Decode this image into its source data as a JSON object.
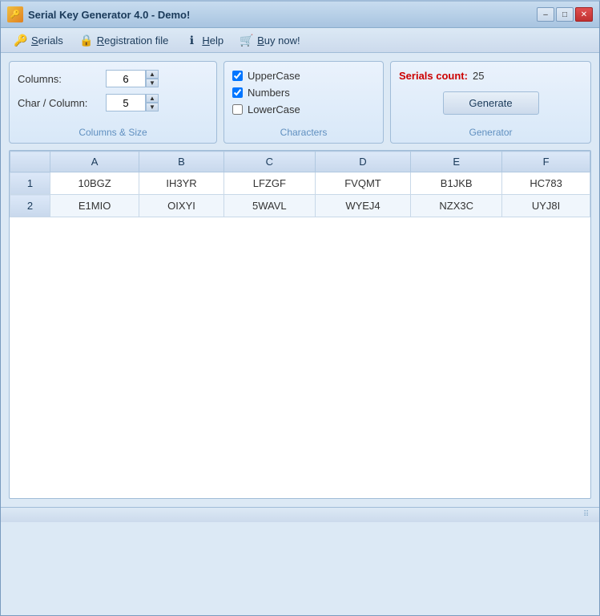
{
  "window": {
    "title": "Serial Key Generator 4.0 - Demo!",
    "icon": "🔑"
  },
  "titlebar_buttons": {
    "minimize": "–",
    "maximize": "□",
    "close": "✕"
  },
  "menu": {
    "items": [
      {
        "id": "serials",
        "icon": "🔑",
        "label": "Serials",
        "underline": "S"
      },
      {
        "id": "registration",
        "icon": "🔒",
        "label": "Registration file",
        "underline": "R"
      },
      {
        "id": "help",
        "icon": "ℹ",
        "label": "Help",
        "underline": "H"
      },
      {
        "id": "buy",
        "icon": "🛒",
        "label": "Buy now!",
        "underline": "B"
      }
    ]
  },
  "panels": {
    "columns_size": {
      "label": "Columns & Size",
      "columns_label": "Columns:",
      "columns_value": "6",
      "char_column_label": "Char / Column:",
      "char_column_value": "5"
    },
    "characters": {
      "label": "Characters",
      "checkboxes": [
        {
          "id": "uppercase",
          "label": "UpperCase",
          "checked": true
        },
        {
          "id": "numbers",
          "label": "Numbers",
          "checked": true
        },
        {
          "id": "lowercase",
          "label": "LowerCase",
          "checked": false
        }
      ]
    },
    "generator": {
      "label": "Generator",
      "serials_count_label": "Serials count:",
      "serials_count_value": "25",
      "generate_button": "Generate"
    }
  },
  "table": {
    "columns": [
      "A",
      "B",
      "C",
      "D",
      "E",
      "F"
    ],
    "rows": [
      {
        "num": "1",
        "cells": [
          "10BGZ",
          "IH3YR",
          "LFZGF",
          "FVQMT",
          "B1JKB",
          "HC783"
        ]
      },
      {
        "num": "2",
        "cells": [
          "E1MIO",
          "OIXYI",
          "5WAVL",
          "WYEJ4",
          "NZX3C",
          "UYJ8I"
        ]
      }
    ]
  }
}
